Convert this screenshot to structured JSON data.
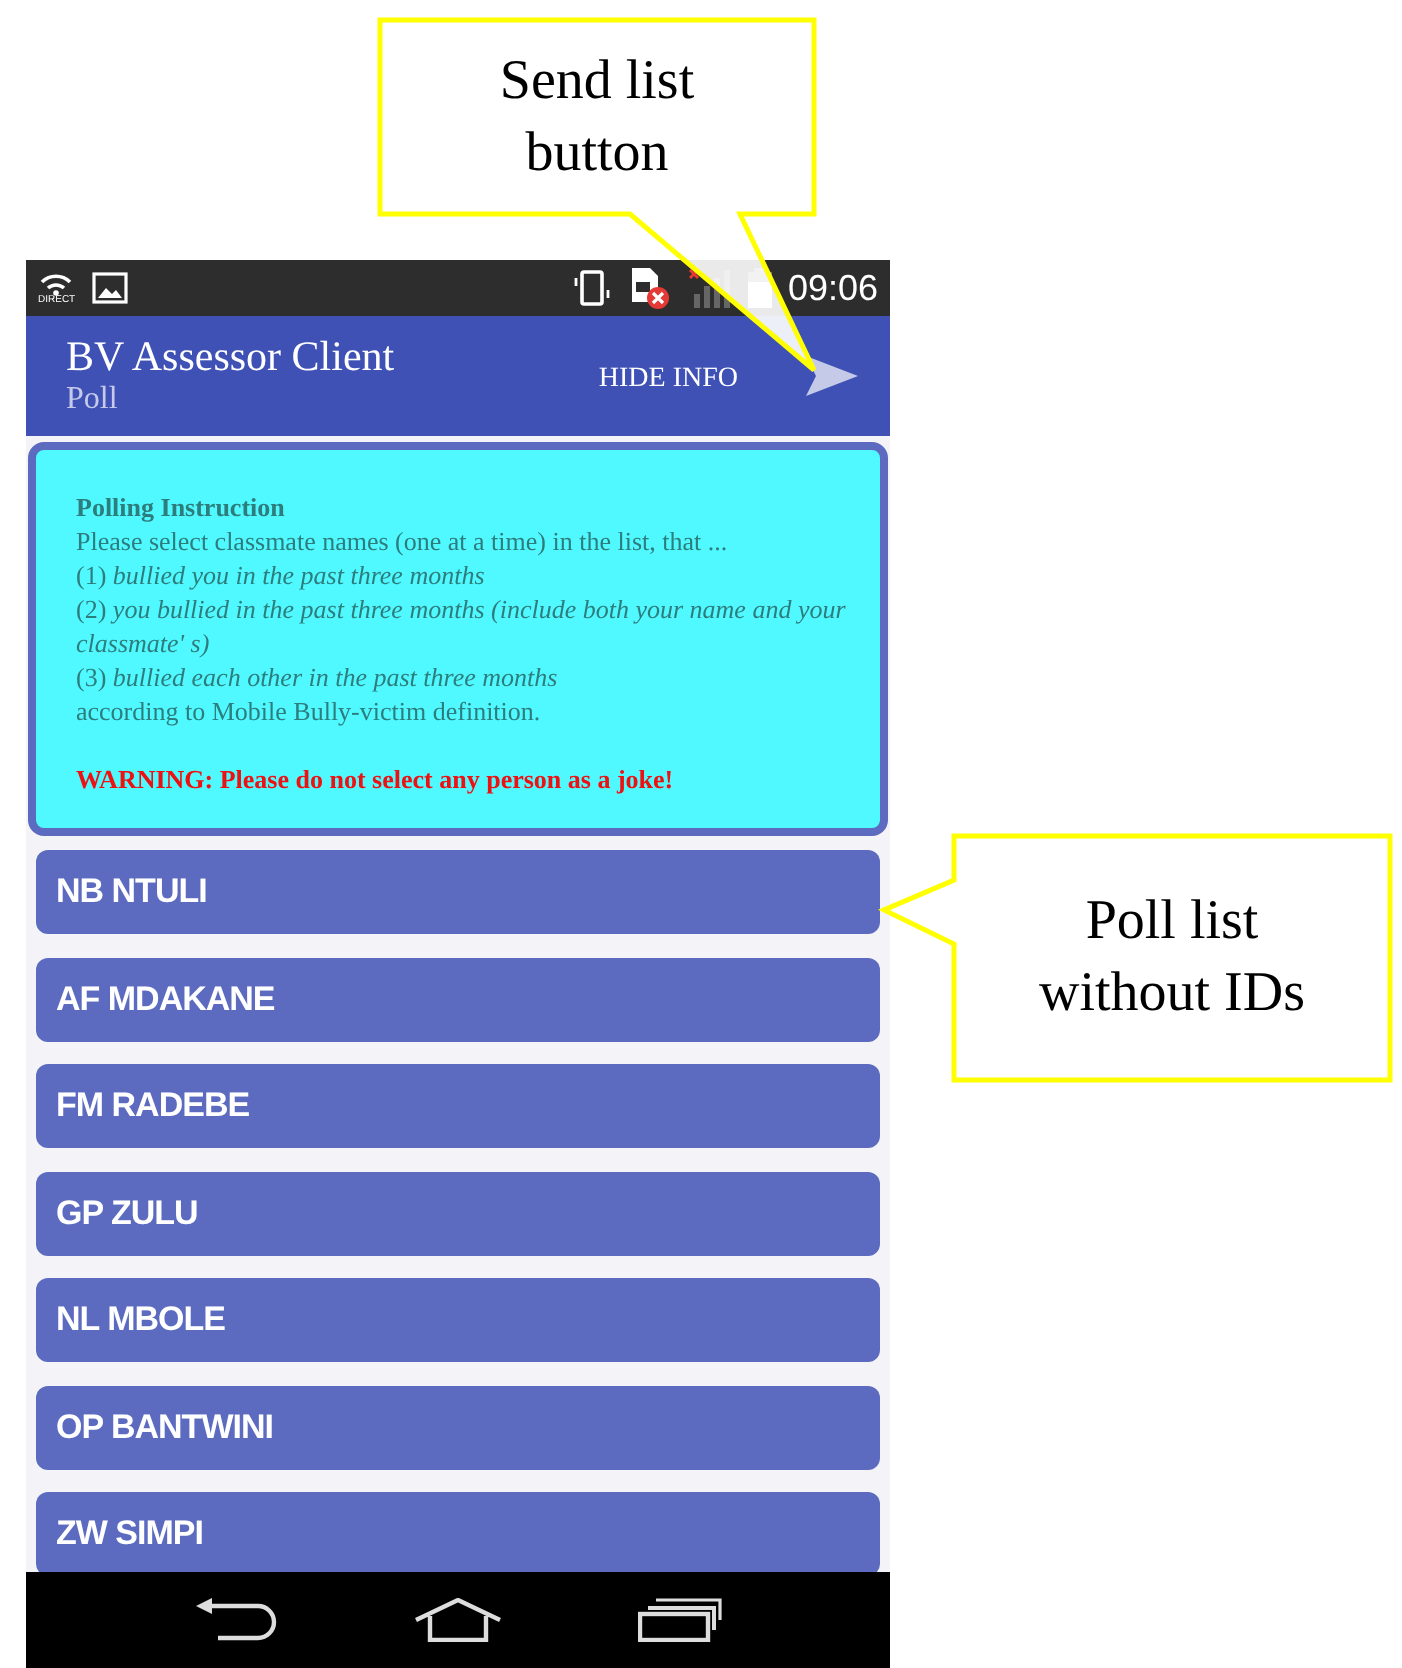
{
  "status_bar": {
    "time": "09:06",
    "wifi_label": "DIRECT"
  },
  "app_bar": {
    "title": "BV Assessor Client",
    "subtitle": "Poll",
    "hide_info": "HIDE INFO"
  },
  "instruction": {
    "heading": "Polling Instruction",
    "lines": [
      "Please select classmate names (one at a time) in the list, that ...",
      "(1) *bullied you in the past three months*",
      "(2) *you bullied in the past three months (include both your name and your classmate' s)*",
      "(3) *bullied each other in the past three months*",
      "according to Mobile Bully-victim definition."
    ],
    "warning": "WARNING: Please do not select any person as a joke!"
  },
  "poll_list": [
    "NB NTULI",
    "AF MDAKANE",
    "FM RADEBE",
    "GP ZULU",
    "NL MBOLE",
    "OP BANTWINI",
    "ZW SIMPI"
  ],
  "callouts": [
    {
      "kind": "top",
      "text": "Send list button"
    },
    {
      "kind": "side",
      "text": "Poll list without IDs"
    }
  ]
}
